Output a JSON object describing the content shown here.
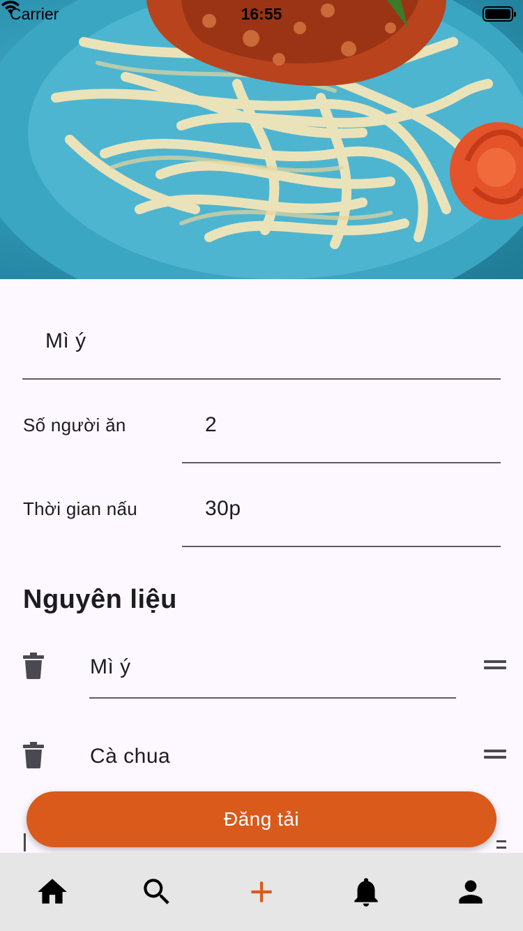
{
  "status_bar": {
    "carrier": "Carrier",
    "time": "16:55"
  },
  "recipe": {
    "name": "Mì ý",
    "servings_label": "Số người ăn",
    "servings_value": "2",
    "cook_time_label": "Thời gian nấu",
    "cook_time_value": "30p"
  },
  "ingredients": {
    "title": "Nguyên liệu",
    "items": [
      "Mì ý",
      "Cà chua"
    ]
  },
  "upload_button": {
    "label": "Đăng tải"
  },
  "bottom_nav": {
    "items": [
      "home-icon",
      "search-icon",
      "add-icon",
      "bell-icon",
      "person-icon"
    ],
    "active_color": "#d95a1a"
  },
  "colors": {
    "accent": "#d95a1a",
    "background": "#fdf7ff",
    "nav_background": "#e6e6e6"
  }
}
